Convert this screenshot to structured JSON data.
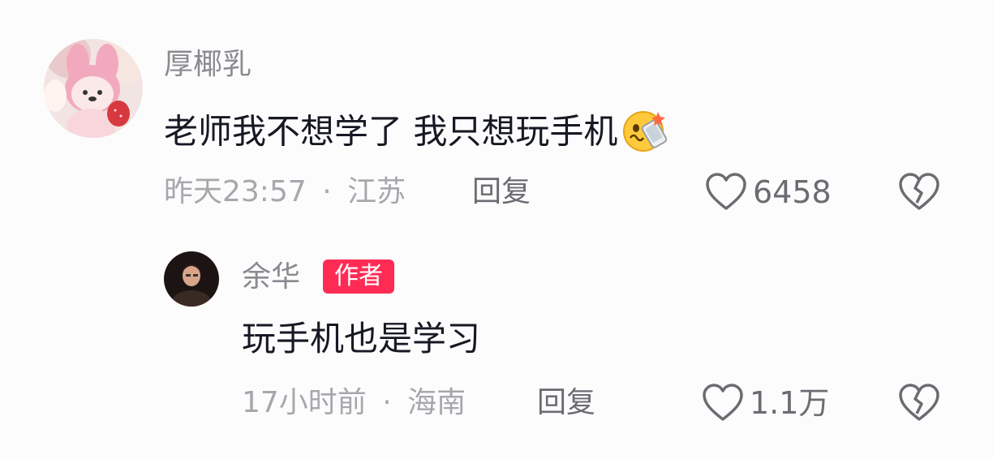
{
  "comment": {
    "username": "厚椰乳",
    "text": "老师我不想学了 我只想玩手机",
    "emoji": "shocked-face-emoji",
    "time": "昨天23:57",
    "separator": "·",
    "location": "江苏",
    "reply_label": "回复",
    "like_count": "6458"
  },
  "reply": {
    "username": "余华",
    "badge": "作者",
    "text": "玩手机也是学习",
    "time": "17小时前",
    "separator": "·",
    "location": "海南",
    "reply_label": "回复",
    "like_count": "1.1万"
  },
  "colors": {
    "accent": "#fe2c55",
    "text_primary": "#161823",
    "text_secondary": "#8a8b91",
    "text_meta": "#a7a8ad"
  },
  "icons": {
    "like": "heart-outline-icon",
    "dislike": "broken-heart-icon"
  }
}
